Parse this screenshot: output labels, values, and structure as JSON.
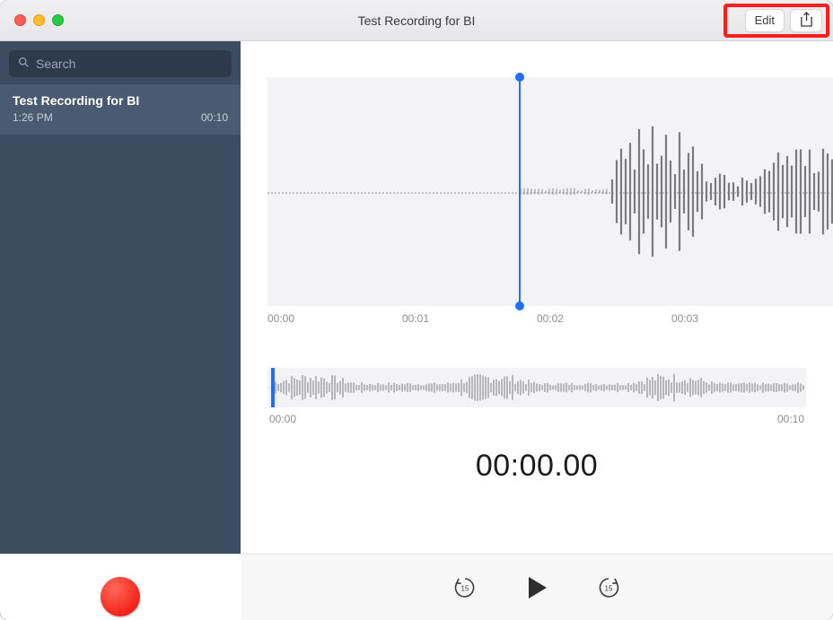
{
  "titlebar": {
    "title": "Test Recording for BI",
    "edit_label": "Edit"
  },
  "search": {
    "placeholder": "Search"
  },
  "recordings": [
    {
      "title": "Test Recording for BI",
      "time": "1:26 PM",
      "duration": "00:10"
    }
  ],
  "zoom_ticks": [
    "00:00",
    "00:01",
    "00:02",
    "00:03"
  ],
  "overview_ticks": {
    "start": "00:00",
    "end": "00:10"
  },
  "timecounter": "00:00.00",
  "skip_seconds": "15"
}
